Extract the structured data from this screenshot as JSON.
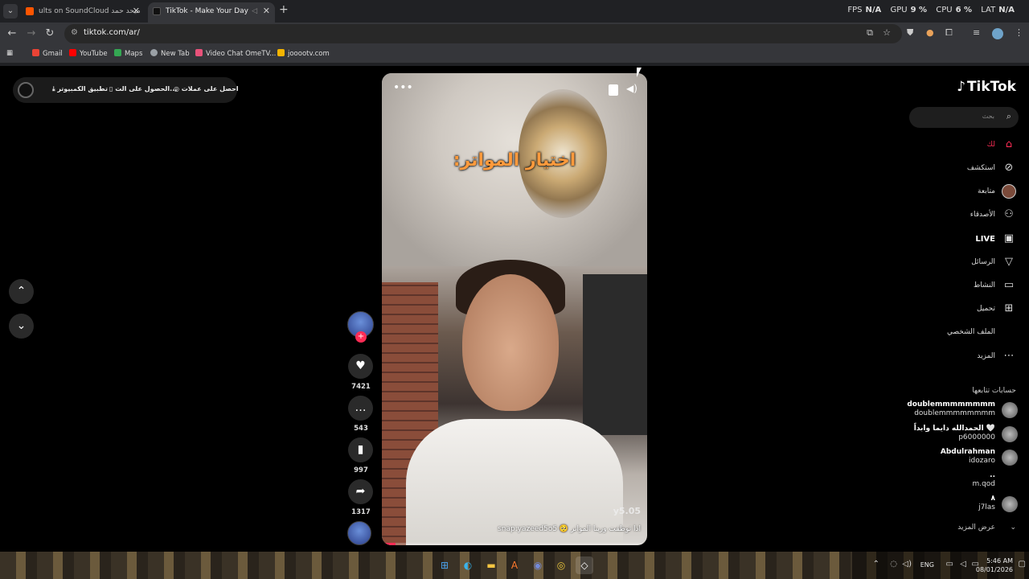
{
  "browser": {
    "tabs": [
      {
        "label": "ults on SoundCloud ميحد حمد"
      },
      {
        "label": "TikTok - Make Your Day"
      }
    ],
    "url": "tiktok.com/ar/",
    "perf": {
      "fps_label": "FPS",
      "fps_value": "N/A",
      "gpu_label": "GPU",
      "gpu_value": "9 %",
      "cpu_label": "CPU",
      "cpu_value": "6 %",
      "lat_label": "LAT",
      "lat_value": "N/A"
    },
    "bookmarks": [
      {
        "label": "Gmail",
        "color": "#ea4335"
      },
      {
        "label": "YouTube",
        "color": "#ff0000"
      },
      {
        "label": "Maps",
        "color": "#34a853"
      },
      {
        "label": "New Tab",
        "color": "#9aa0a6"
      },
      {
        "label": "Video Chat OmeTV...",
        "color": "#e8527a"
      },
      {
        "label": "jooootv.com",
        "color": "#f4b400"
      }
    ]
  },
  "promo_bar": {
    "coins": "احصل على عملات",
    "app": "الحصول على الت...",
    "desktop": "تطبيق الكمبيوتر"
  },
  "video": {
    "overlay_text": "اختيار المواتر:",
    "watermark": "y5.05",
    "caption": "اذا توظفت وربنا المواتر 🥺 snap:yazeed5o5",
    "progress": 0.05
  },
  "actions": {
    "likes": "7421",
    "comments": "543",
    "saves": "997",
    "shares": "1317"
  },
  "sidebar": {
    "logo": "TikTok",
    "search_placeholder": "بحث",
    "nav": [
      {
        "label": "لك",
        "icon": "home-icon",
        "active": true
      },
      {
        "label": "استكشف",
        "icon": "compass-icon"
      },
      {
        "label": "متابعة",
        "icon": "following-avatar-icon"
      },
      {
        "label": "الأصدقاء",
        "icon": "friends-icon"
      },
      {
        "label": "LIVE",
        "icon": "live-icon"
      },
      {
        "label": "الرسائل",
        "icon": "messages-icon"
      },
      {
        "label": "النشاط",
        "icon": "activity-icon"
      },
      {
        "label": "تحميل",
        "icon": "upload-icon"
      },
      {
        "label": "الملف الشخصي",
        "icon": "profile-icon"
      },
      {
        "label": "المزيد",
        "icon": "more-icon"
      }
    ],
    "following_title": "حسابات تتابعها",
    "accounts": [
      {
        "name": "doublemmmmmmmm",
        "handle": "doublemmmmmmmm"
      },
      {
        "name": "الحمدالله دايما وابداً 🤍",
        "handle": "p6000000"
      },
      {
        "name": "Abdulrahman",
        "handle": "idozaro"
      },
      {
        "name": "..",
        "handle": "m.qod"
      },
      {
        "name": "٨",
        "handle": "j7las"
      }
    ],
    "see_more": "عرض المزيد"
  },
  "taskbar": {
    "lang": "ENG",
    "time": "5:46 AM",
    "date": "08/01/2026"
  }
}
